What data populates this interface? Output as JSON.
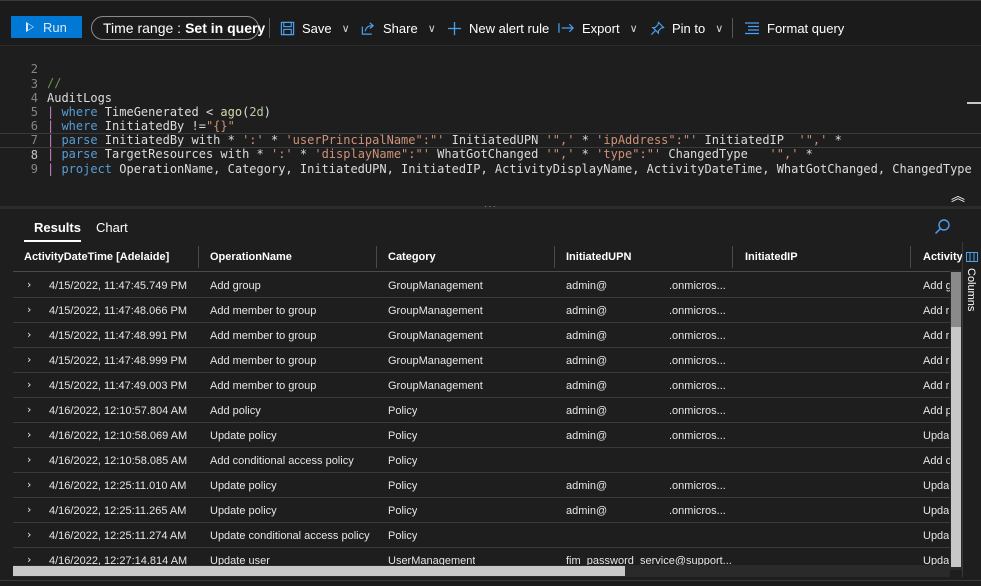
{
  "toolbar": {
    "run_label": "Run",
    "time_range_prefix": "Time range :",
    "time_range_value": "Set in query",
    "save_label": "Save",
    "share_label": "Share",
    "new_alert_label": "New alert rule",
    "export_label": "Export",
    "pin_label": "Pin to",
    "format_label": "Format query"
  },
  "editor": {
    "line_numbers": [
      "2",
      "3",
      "4",
      "5",
      "6",
      "7",
      "8",
      "9"
    ],
    "lines": {
      "l2": "//",
      "l3": "AuditLogs",
      "l4_kw": "where",
      "l4_a": " TimeGenerated < ",
      "l4_fn": "ago",
      "l4_b": "(",
      "l4_num": "2d",
      "l4_c": ")",
      "l5_kw": "where",
      "l5_a": " InitiatedBy !=",
      "l5_str": "\"{}\"",
      "l6_kw": "parse",
      "l6_a": " InitiatedBy with * ",
      "l6_s1": "':'",
      "l6_b": " * ",
      "l6_s2": "'userPrincipalName\":\"'",
      "l6_c": " InitiatedUPN ",
      "l6_s3": "'\",'",
      "l6_d": " * ",
      "l6_s4": "'ipAddress\":\"'",
      "l6_e": " InitiatedIP  ",
      "l6_s5": "'\",'",
      "l6_f": " *",
      "l7_kw": "parse",
      "l7_a": " TargetResources with * ",
      "l7_s1": "':'",
      "l7_b": " * ",
      "l7_s2": "'displayName\":\"'",
      "l7_c": " WhatGotChanged ",
      "l7_s3": "'\",'",
      "l7_d": " * ",
      "l7_s4": "'type\":\"'",
      "l7_e": " ChangedType   ",
      "l7_s5": "'\",'",
      "l7_f": " *",
      "l8_kw": "project",
      "l8_a": " OperationName, Category, InitiatedUPN, InitiatedIP, ActivityDisplayName, ActivityDateTime, WhatGotChanged, ChangedType"
    }
  },
  "results": {
    "tabs": [
      "Results",
      "Chart"
    ],
    "columns": [
      "ActivityDateTime [Adelaide]",
      "OperationName",
      "Category",
      "InitiatedUPN",
      "InitiatedIP",
      "ActivityI"
    ],
    "columns_panel_label": "Columns",
    "rows": [
      {
        "dt": "4/15/2022, 11:47:45.749 PM",
        "op": "Add group",
        "cat": "GroupManagement",
        "upn1": "admin@",
        "upn2": ".onmicros...",
        "act": "Add g"
      },
      {
        "dt": "4/15/2022, 11:47:48.066 PM",
        "op": "Add member to group",
        "cat": "GroupManagement",
        "upn1": "admin@",
        "upn2": ".onmicros...",
        "act": "Add r"
      },
      {
        "dt": "4/15/2022, 11:47:48.991 PM",
        "op": "Add member to group",
        "cat": "GroupManagement",
        "upn1": "admin@",
        "upn2": ".onmicros...",
        "act": "Add r"
      },
      {
        "dt": "4/15/2022, 11:47:48.999 PM",
        "op": "Add member to group",
        "cat": "GroupManagement",
        "upn1": "admin@",
        "upn2": ".onmicros...",
        "act": "Add r"
      },
      {
        "dt": "4/15/2022, 11:47:49.003 PM",
        "op": "Add member to group",
        "cat": "GroupManagement",
        "upn1": "admin@",
        "upn2": ".onmicros...",
        "act": "Add r"
      },
      {
        "dt": "4/16/2022, 12:10:57.804 AM",
        "op": "Add policy",
        "cat": "Policy",
        "upn1": "admin@",
        "upn2": ".onmicros...",
        "act": "Add p"
      },
      {
        "dt": "4/16/2022, 12:10:58.069 AM",
        "op": "Update policy",
        "cat": "Policy",
        "upn1": "admin@",
        "upn2": ".onmicros...",
        "act": "Upda"
      },
      {
        "dt": "4/16/2022, 12:10:58.085 AM",
        "op": "Add conditional access policy",
        "cat": "Policy",
        "upn1": "",
        "upn2": "",
        "act": "Add c"
      },
      {
        "dt": "4/16/2022, 12:25:11.010 AM",
        "op": "Update policy",
        "cat": "Policy",
        "upn1": "admin@",
        "upn2": ".onmicros...",
        "act": "Upda"
      },
      {
        "dt": "4/16/2022, 12:25:11.265 AM",
        "op": "Update policy",
        "cat": "Policy",
        "upn1": "admin@",
        "upn2": ".onmicros...",
        "act": "Upda"
      },
      {
        "dt": "4/16/2022, 12:25:11.274 AM",
        "op": "Update conditional access policy",
        "cat": "Policy",
        "upn1": "",
        "upn2": "",
        "act": "Upda"
      },
      {
        "dt": "4/16/2022, 12:27:14.814 AM",
        "op": "Update user",
        "cat": "UserManagement",
        "upn1": "fim_password_service@support...",
        "upn2": "",
        "act": "Upda"
      }
    ]
  },
  "icons": {
    "run": "play-icon",
    "save": "save-icon",
    "share": "share-icon",
    "new_alert": "plus-icon",
    "export": "export-arrow-icon",
    "pin": "pin-icon",
    "format": "format-lines-icon",
    "collapse": "double-chevron-up-icon",
    "search": "search-icon",
    "columns": "columns-icon",
    "expand": "chevron-right-icon"
  },
  "colors": {
    "run_button": "#0078d4",
    "background": "#1e1e1e",
    "keyword": "#569cd6",
    "string": "#ce9178"
  }
}
